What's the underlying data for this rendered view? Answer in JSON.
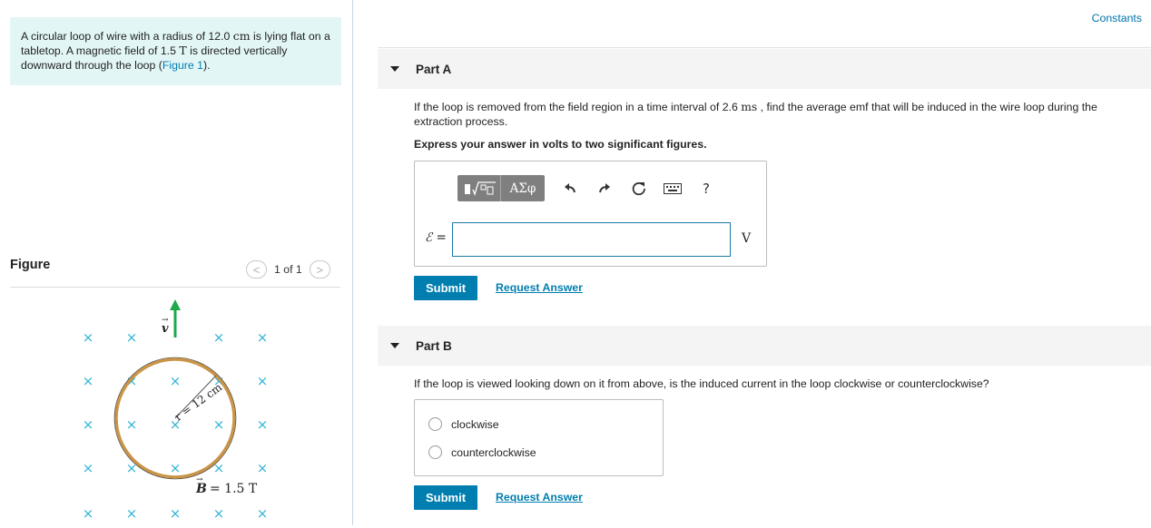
{
  "problem": {
    "t1": "A circular loop of wire with a radius of 12.0 ",
    "t1u": "cm",
    "t2": " is lying flat on a tabletop. A magnetic field of 1.5 ",
    "t2u": "T",
    "t3": " is directed vertically downward through the loop (",
    "fig_link": "Figure 1",
    "t4": ")."
  },
  "figure_panel": {
    "title": "Figure",
    "page": "1 of 1",
    "prev": "<",
    "next": ">",
    "cross": "×",
    "v_label": "v",
    "r_label": "r = 12 cm",
    "b_label": "B",
    "b_value": "= 1.5 T",
    "colors": {
      "crosses": "#30b4d6",
      "loop": "#c99548",
      "arrow": "#1ea84b"
    }
  },
  "header": {
    "constants": "Constants"
  },
  "part_a": {
    "title": "Part A",
    "q1": "If the loop is removed from the field region in a time interval of 2.6 ",
    "q1u": "ms",
    "q2": " , find the average emf that will be induced in the wire loop during the extraction process.",
    "instruction": "Express your answer in volts to two significant figures.",
    "toolbar": {
      "greek": "ΑΣφ",
      "help": "?"
    },
    "icons": [
      "template-icon",
      "undo-icon",
      "redo-icon",
      "reset-icon",
      "keyboard-icon",
      "help-icon"
    ],
    "eq_label": "ℰ =",
    "answer_value": "",
    "unit": "V",
    "submit": "Submit",
    "request": "Request Answer"
  },
  "part_b": {
    "title": "Part B",
    "question": "If the loop is viewed looking down on it from above, is the induced current in the loop clockwise or counterclockwise?",
    "options": [
      "clockwise",
      "counterclockwise"
    ],
    "submit": "Submit",
    "request": "Request Answer"
  }
}
